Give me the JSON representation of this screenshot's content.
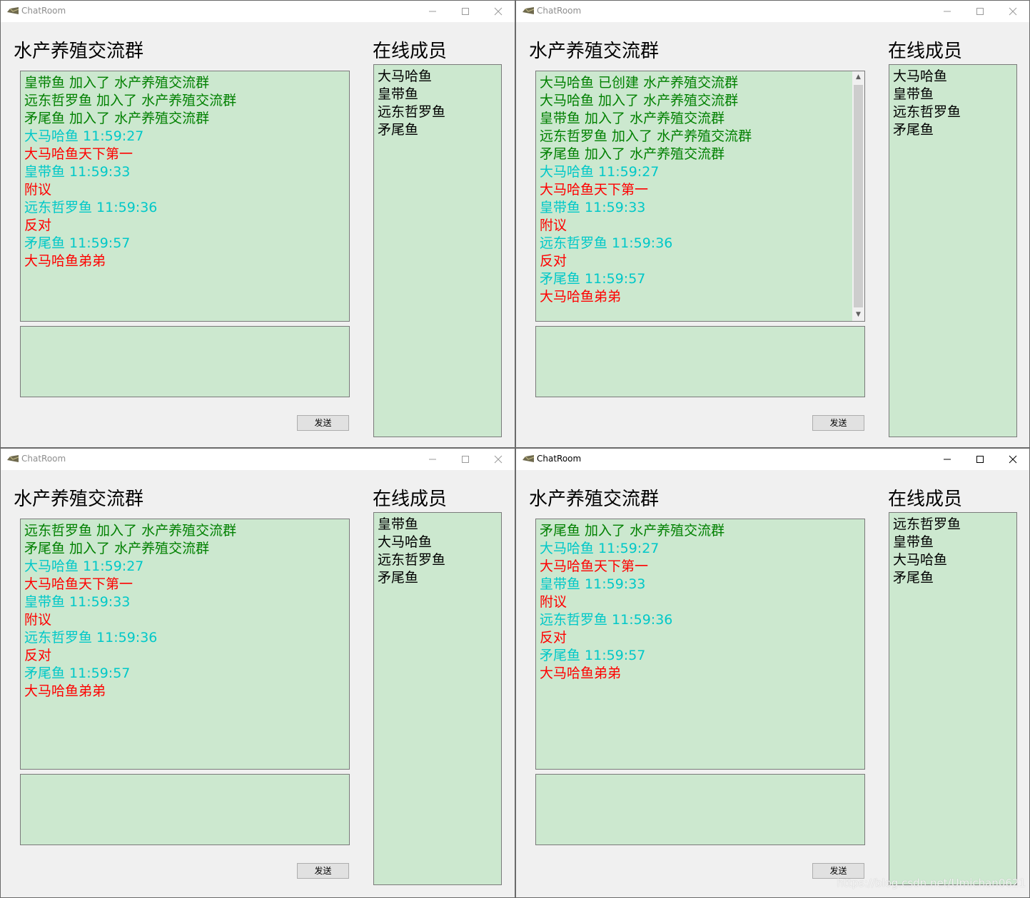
{
  "windows": [
    {
      "title": "ChatRoom",
      "group_name": "水产养殖交流群",
      "members_title": "在线成员",
      "send_label": "发送",
      "messages": [
        {
          "text": "皇带鱼 加入了 水产养殖交流群",
          "kind": "sys"
        },
        {
          "text": "远东哲罗鱼 加入了 水产养殖交流群",
          "kind": "sys"
        },
        {
          "text": "矛尾鱼 加入了 水产养殖交流群",
          "kind": "sys"
        },
        {
          "text": "大马哈鱼 11:59:27",
          "kind": "time"
        },
        {
          "text": "大马哈鱼天下第一",
          "kind": "msg"
        },
        {
          "text": "皇带鱼 11:59:33",
          "kind": "time"
        },
        {
          "text": "附议",
          "kind": "msg"
        },
        {
          "text": "远东哲罗鱼 11:59:36",
          "kind": "time"
        },
        {
          "text": "反对",
          "kind": "msg"
        },
        {
          "text": "矛尾鱼 11:59:57",
          "kind": "time"
        },
        {
          "text": "大马哈鱼弟弟",
          "kind": "msg"
        }
      ],
      "members": [
        "大马哈鱼",
        "皇带鱼",
        "远东哲罗鱼",
        "矛尾鱼"
      ],
      "has_scrollbar": false,
      "active": false
    },
    {
      "title": "ChatRoom",
      "group_name": "水产养殖交流群",
      "members_title": "在线成员",
      "send_label": "发送",
      "messages": [
        {
          "text": "大马哈鱼 已创建 水产养殖交流群",
          "kind": "sys"
        },
        {
          "text": "大马哈鱼 加入了 水产养殖交流群",
          "kind": "sys"
        },
        {
          "text": "皇带鱼 加入了 水产养殖交流群",
          "kind": "sys"
        },
        {
          "text": "远东哲罗鱼 加入了 水产养殖交流群",
          "kind": "sys"
        },
        {
          "text": "矛尾鱼 加入了 水产养殖交流群",
          "kind": "sys"
        },
        {
          "text": "大马哈鱼 11:59:27",
          "kind": "time"
        },
        {
          "text": "大马哈鱼天下第一",
          "kind": "msg"
        },
        {
          "text": "皇带鱼 11:59:33",
          "kind": "time"
        },
        {
          "text": "附议",
          "kind": "msg"
        },
        {
          "text": "远东哲罗鱼 11:59:36",
          "kind": "time"
        },
        {
          "text": "反对",
          "kind": "msg"
        },
        {
          "text": "矛尾鱼 11:59:57",
          "kind": "time"
        },
        {
          "text": "大马哈鱼弟弟",
          "kind": "msg"
        }
      ],
      "members": [
        "大马哈鱼",
        "皇带鱼",
        "远东哲罗鱼",
        "矛尾鱼"
      ],
      "has_scrollbar": true,
      "active": false
    },
    {
      "title": "ChatRoom",
      "group_name": "水产养殖交流群",
      "members_title": "在线成员",
      "send_label": "发送",
      "messages": [
        {
          "text": "远东哲罗鱼 加入了 水产养殖交流群",
          "kind": "sys"
        },
        {
          "text": "矛尾鱼 加入了 水产养殖交流群",
          "kind": "sys"
        },
        {
          "text": "大马哈鱼 11:59:27",
          "kind": "time"
        },
        {
          "text": "大马哈鱼天下第一",
          "kind": "msg"
        },
        {
          "text": "皇带鱼 11:59:33",
          "kind": "time"
        },
        {
          "text": "附议",
          "kind": "msg"
        },
        {
          "text": "远东哲罗鱼 11:59:36",
          "kind": "time"
        },
        {
          "text": "反对",
          "kind": "msg"
        },
        {
          "text": "矛尾鱼 11:59:57",
          "kind": "time"
        },
        {
          "text": "大马哈鱼弟弟",
          "kind": "msg"
        }
      ],
      "members": [
        "皇带鱼",
        "大马哈鱼",
        "远东哲罗鱼",
        "矛尾鱼"
      ],
      "has_scrollbar": false,
      "active": false
    },
    {
      "title": "ChatRoom",
      "group_name": "水产养殖交流群",
      "members_title": "在线成员",
      "send_label": "发送",
      "messages": [
        {
          "text": "矛尾鱼 加入了 水产养殖交流群",
          "kind": "sys"
        },
        {
          "text": "大马哈鱼 11:59:27",
          "kind": "time"
        },
        {
          "text": "大马哈鱼天下第一",
          "kind": "msg"
        },
        {
          "text": "皇带鱼 11:59:33",
          "kind": "time"
        },
        {
          "text": "附议",
          "kind": "msg"
        },
        {
          "text": "远东哲罗鱼 11:59:36",
          "kind": "time"
        },
        {
          "text": "反对",
          "kind": "msg"
        },
        {
          "text": "矛尾鱼 11:59:57",
          "kind": "time"
        },
        {
          "text": "大马哈鱼弟弟",
          "kind": "msg"
        }
      ],
      "members": [
        "远东哲罗鱼",
        "皇带鱼",
        "大马哈鱼",
        "矛尾鱼"
      ],
      "has_scrollbar": false,
      "active": true
    }
  ],
  "message_colors": {
    "sys": "#008000",
    "time": "#00c8c8",
    "msg": "#ff0000"
  },
  "list_background": "#cce8cf",
  "watermark": "https://blog.csdn.net/Umichan0621"
}
